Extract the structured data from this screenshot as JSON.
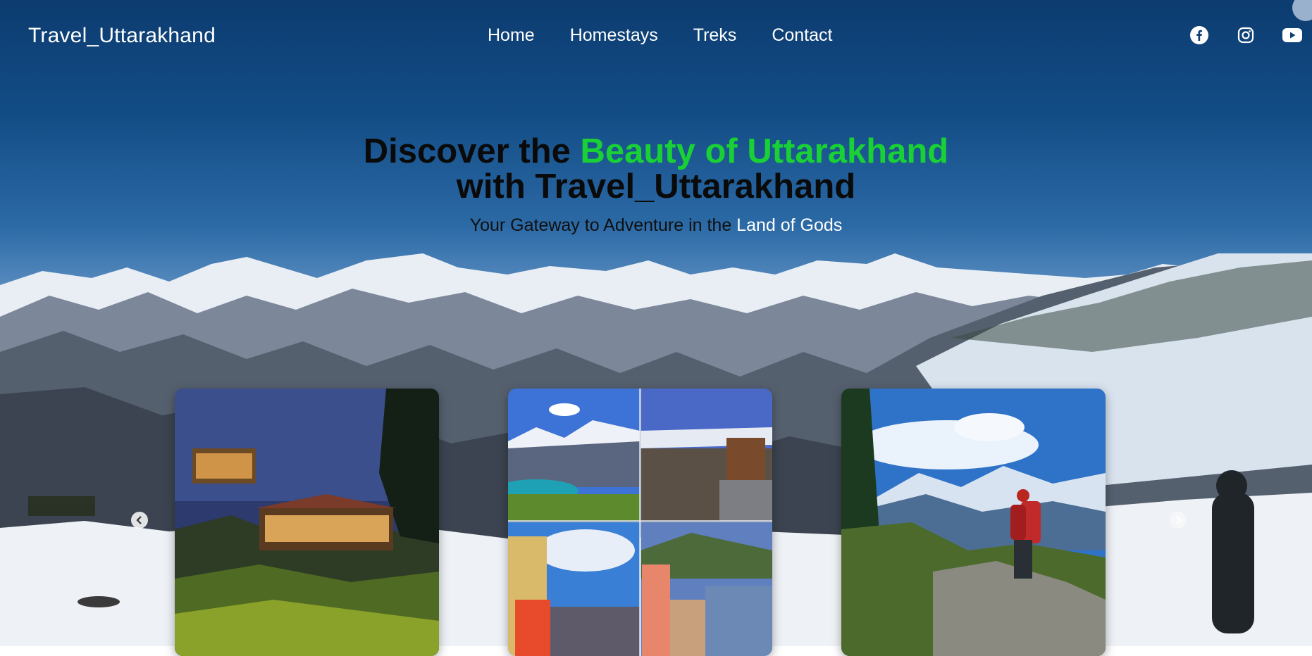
{
  "brand": "Travel_Uttarakhand",
  "nav": {
    "items": [
      {
        "label": "Home"
      },
      {
        "label": "Homestays"
      },
      {
        "label": "Treks"
      },
      {
        "label": "Contact"
      }
    ]
  },
  "social": {
    "icons": [
      "facebook-icon",
      "instagram-icon",
      "youtube-icon"
    ]
  },
  "hero": {
    "headline_part1": "Discover the ",
    "headline_accent": "Beauty of Uttarakhand",
    "headline_part2": "with Travel_Uttarakhand",
    "tagline_part1": "Your Gateway to Adventure in the ",
    "tagline_accent": "Land of Gods",
    "accent_color": "#19d134"
  },
  "carousel": {
    "cards": [
      "homestay-night-photo",
      "destination-collage",
      "trekker-photo"
    ],
    "prev_icon": "chevron-left-icon",
    "next_icon": "chevron-right-icon"
  }
}
